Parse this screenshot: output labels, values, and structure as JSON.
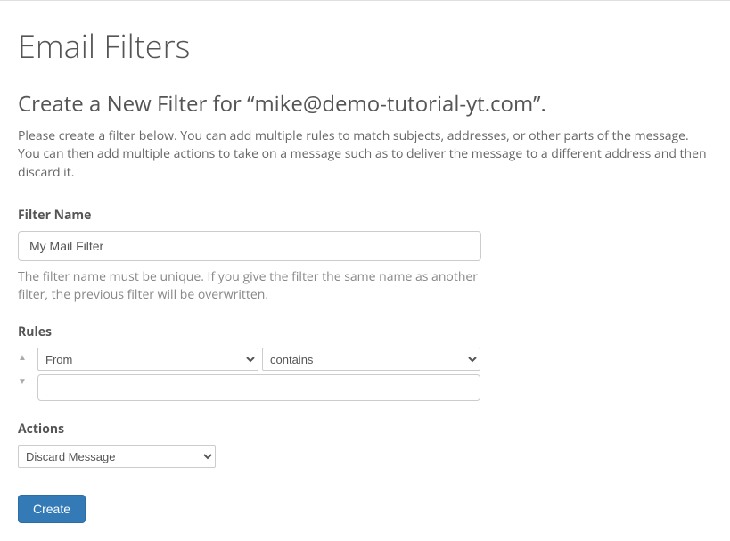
{
  "page": {
    "title": "Email Filters",
    "subtitle": "Create a New Filter for “mike@demo-tutorial-yt.com”.",
    "description": "Please create a filter below. You can add multiple rules to match subjects, addresses, or other parts of the message. You can then add multiple actions to take on a message such as to deliver the message to a different address and then discard it."
  },
  "filter_name": {
    "label": "Filter Name",
    "value": "My Mail Filter",
    "helper": "The filter name must be unique. If you give the filter the same name as another filter, the previous filter will be overwritten."
  },
  "rules": {
    "label": "Rules",
    "part_selected": "From",
    "match_selected": "contains",
    "value": ""
  },
  "actions": {
    "label": "Actions",
    "selected": "Discard Message"
  },
  "buttons": {
    "create": "Create"
  }
}
